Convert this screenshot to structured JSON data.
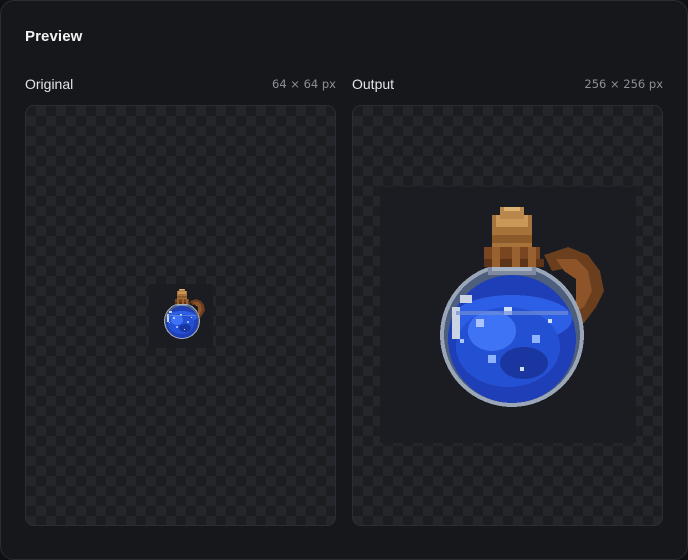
{
  "panel": {
    "title": "Preview"
  },
  "original": {
    "label": "Original",
    "dimensions": "64 × 64 px",
    "image_icon": "potion-sprite-icon"
  },
  "output": {
    "label": "Output",
    "dimensions": "256 × 256 px",
    "image_icon": "potion-sprite-icon"
  },
  "colors": {
    "background": "#16171b",
    "border": "#2b2d34",
    "potion_blue": "#1d4fe0",
    "cork_brown": "#b07a3c"
  }
}
